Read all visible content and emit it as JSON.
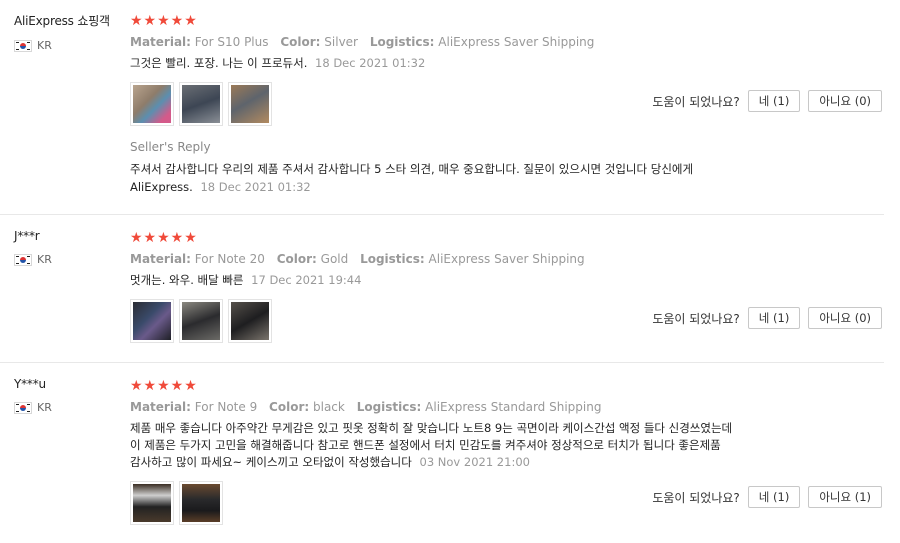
{
  "colors": {
    "star": "#f04a3a",
    "muted": "#999999",
    "border": "#e8e8e8"
  },
  "icons": {
    "flag": "kr-flag-icon",
    "star": "star-icon"
  },
  "reviews": [
    {
      "user": "AliExpress 쇼핑객",
      "country": "KR",
      "stars": "★★★★★",
      "rating": 5,
      "material_label": "Material:",
      "material": "For S10 Plus",
      "color_label": "Color:",
      "color": "Silver",
      "logistics_label": "Logistics:",
      "logistics": "AliExpress Saver Shipping",
      "text": "그것은 빨리. 포장. 나는 이 프로듀서.",
      "date": "18 Dec 2021 01:32",
      "helpful_q": "도움이 되었나요?",
      "yes": "네 (1)",
      "no": "아니요 (0)",
      "reply_title": "Seller's Reply",
      "reply_text": "주셔서 감사합니다 우리의 제품 주셔서 감사합니다 5 스타 의견, 매우 중요합니다. 질문이 있으시면 것입니다 당신에게",
      "reply_text2": "AliExpress.",
      "reply_date": "18 Dec 2021 01:32"
    },
    {
      "user": "J***r",
      "country": "KR",
      "stars": "★★★★★",
      "rating": 5,
      "material_label": "Material:",
      "material": "For Note 20",
      "color_label": "Color:",
      "color": "Gold",
      "logistics_label": "Logistics:",
      "logistics": "AliExpress Saver Shipping",
      "text": "멋개는. 와우. 배달 빠른",
      "date": "17 Dec 2021 19:44",
      "helpful_q": "도움이 되었나요?",
      "yes": "네 (1)",
      "no": "아니요 (0)"
    },
    {
      "user": "Y***u",
      "country": "KR",
      "stars": "★★★★★",
      "rating": 5,
      "material_label": "Material:",
      "material": "For Note 9",
      "color_label": "Color:",
      "color": "black",
      "logistics_label": "Logistics:",
      "logistics": "AliExpress Standard Shipping",
      "text1": "제품 매우 좋습니다 아주약간 무게감은 있고 핏옷 정확히 잘 맞습니다 노트8 9는 곡면이라 케이스간섭 액정 들다 신경쓰였는데",
      "text2": "이 제품은 두가지 고민을 해결해줍니다 참고로 핸드폰 설정에서 터치 민감도를 켜주셔야 정상적으로 터치가 됩니다 좋은제품",
      "text3": "감사하고 많이 파세요~ 케이스끼고 오타없이 작성했습니다",
      "date": "03 Nov 2021 21:00",
      "helpful_q": "도움이 되었나요?",
      "yes": "네 (1)",
      "no": "아니요 (1)"
    }
  ]
}
